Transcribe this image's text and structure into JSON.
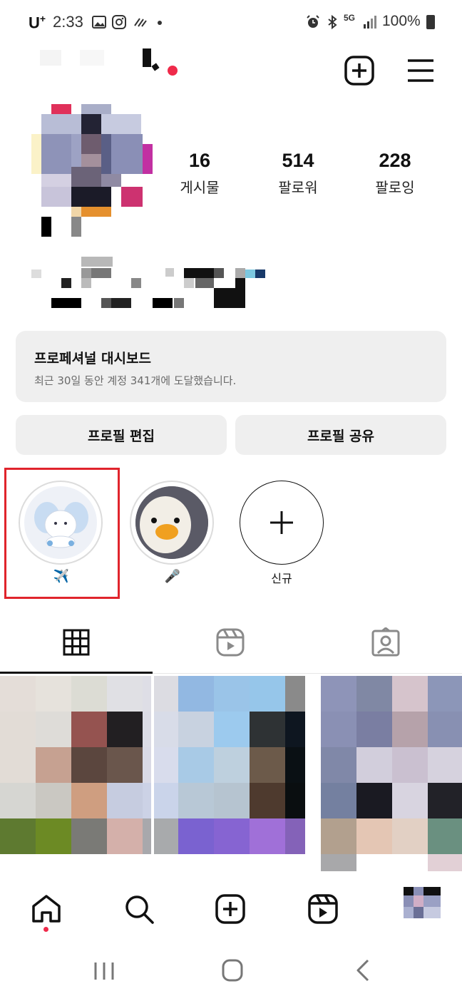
{
  "status_bar": {
    "carrier": "U",
    "carrier_plus": "+",
    "time": "2:33",
    "battery": "100%",
    "net": "5G"
  },
  "profile": {
    "stats": [
      {
        "value": "16",
        "label": "게시물"
      },
      {
        "value": "514",
        "label": "팔로워"
      },
      {
        "value": "228",
        "label": "팔로잉"
      }
    ]
  },
  "dashboard": {
    "title": "프로페셔널 대시보드",
    "subtitle": "최근 30일 동안 계정 341개에 도달했습니다."
  },
  "buttons": {
    "edit": "프로필 편집",
    "share": "프로필 공유"
  },
  "highlights": [
    {
      "label": "✈️",
      "icon": "airplane-emoji"
    },
    {
      "label": "🎤",
      "icon": "microphone-emoji"
    },
    {
      "label": "신규",
      "icon": "plus-icon"
    }
  ],
  "tabs": [
    "grid-icon",
    "reels-icon",
    "tagged-icon"
  ],
  "colors": {
    "accent_red": "#ef2a4a",
    "selection_box": "#e0242c",
    "button_bg": "#efefef"
  }
}
